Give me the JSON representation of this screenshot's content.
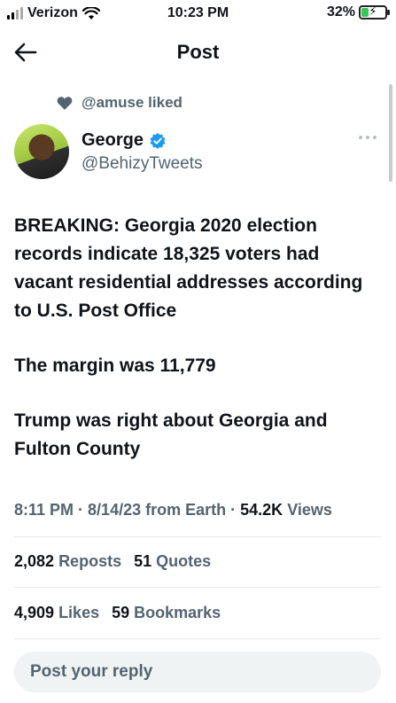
{
  "status_bar": {
    "carrier": "Verizon",
    "time": "10:23 PM",
    "battery_percent": "32%",
    "battery_level": 0.32,
    "battery_color": "#34c759"
  },
  "header": {
    "title": "Post",
    "back_icon": "arrow-left-icon"
  },
  "social_context": {
    "icon": "heart-icon",
    "text": "@amuse liked"
  },
  "author": {
    "name": "George",
    "handle": "@BehizyTweets",
    "verified_icon": "verified-badge-icon",
    "verified_color": "#1d9bf0"
  },
  "tweet": {
    "paragraphs": [
      "BREAKING: Georgia 2020 election records indicate 18,325 voters had vacant residential addresses according to U.S. Post Office",
      "The margin was 11,779",
      "Trump was right about Georgia and Fulton County"
    ]
  },
  "meta": {
    "time": "8:11 PM",
    "date": "8/14/23",
    "source": "from Earth",
    "views_count": "54.2K",
    "views_label": "Views"
  },
  "engagement": {
    "reposts_count": "2,082",
    "reposts_label": "Reposts",
    "quotes_count": "51",
    "quotes_label": "Quotes",
    "likes_count": "4,909",
    "likes_label": "Likes",
    "bookmarks_count": "59",
    "bookmarks_label": "Bookmarks"
  },
  "reply": {
    "placeholder": "Post your reply"
  }
}
